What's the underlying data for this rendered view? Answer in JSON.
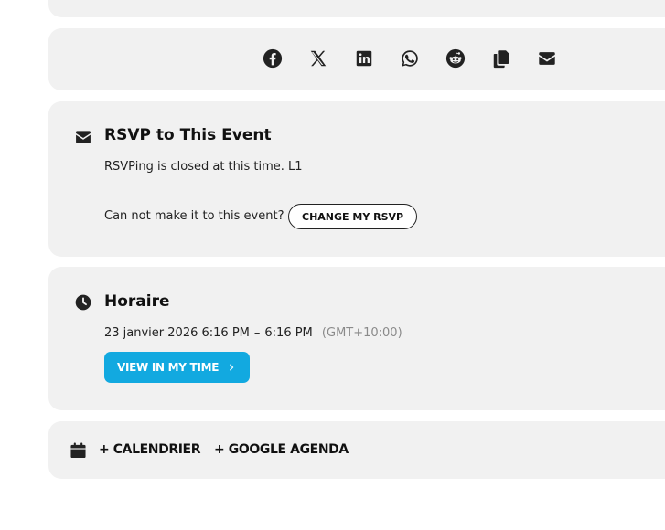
{
  "share": {
    "icons": [
      "facebook-icon",
      "x-icon",
      "linkedin-icon",
      "whatsapp-icon",
      "reddit-icon",
      "copy-icon",
      "email-icon"
    ]
  },
  "rsvp": {
    "title": "RSVP to This Event",
    "closed_text": "RSVPing is closed at this time. L1",
    "cant_make_text": "Can not make it to this event?",
    "change_button": "CHANGE MY RSVP"
  },
  "schedule": {
    "title": "Horaire",
    "date": "23 janvier 2026",
    "start": "6:16 PM",
    "separator": "–",
    "end": "6:16 PM",
    "timezone": "(GMT+10:00)",
    "view_button": "VIEW IN MY TIME"
  },
  "calendar": {
    "links": [
      "+ CALENDRIER",
      "+ GOOGLE AGENDA"
    ]
  },
  "colors": {
    "card_bg": "#f1f1f1",
    "accent": "#12a9e0",
    "text": "#111111",
    "muted": "#8a8a8a"
  }
}
